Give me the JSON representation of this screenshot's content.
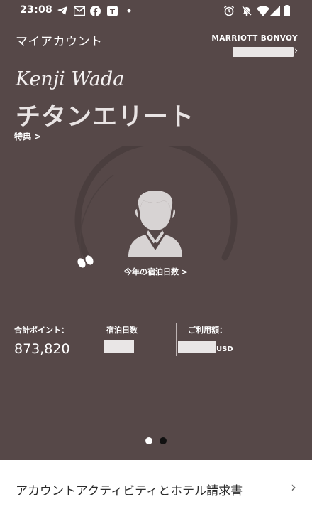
{
  "status_bar": {
    "time": "23:08"
  },
  "header": {
    "title": "マイアカウント",
    "brand": "MARRIOTT BONVOY",
    "member_chevron": "›"
  },
  "profile": {
    "name": "Kenji Wada",
    "tier": "チタンエリート",
    "benefits_link": "特典 >"
  },
  "gauge": {
    "link": "今年の宿泊日数 >"
  },
  "stats": {
    "points_label": "合計ポイント：",
    "points_value": "873,820",
    "nights_label": "宿泊日数",
    "spend_label": "ご利用額：",
    "spend_unit": "USD"
  },
  "pager": {
    "count": 2,
    "active_index": 0
  },
  "bottom_card": {
    "label": "アカウントアクティビティとホテル請求書",
    "chevron": "›"
  },
  "colors": {
    "background": "#564848",
    "card": "#ffffff",
    "gauge_track": "#4a3e3e"
  }
}
